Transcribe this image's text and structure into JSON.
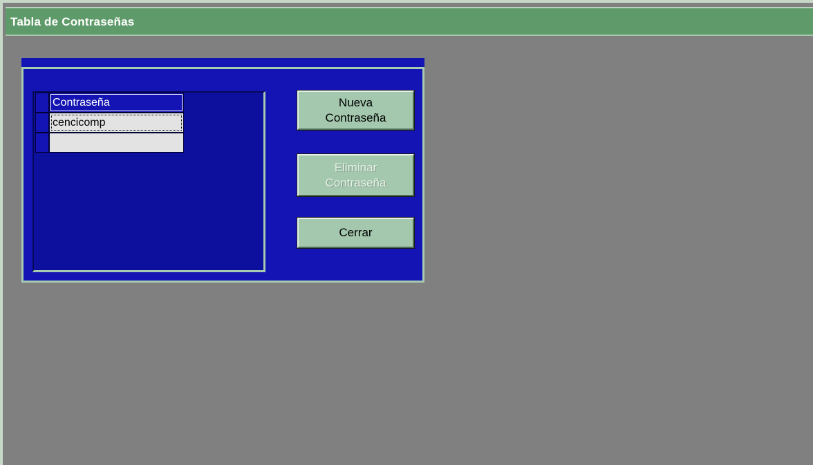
{
  "window": {
    "title": "Tabla de Contraseñas"
  },
  "grid": {
    "header": "Contraseña",
    "rows": [
      "cencicomp",
      ""
    ]
  },
  "buttons": {
    "new_password": [
      "Nueva",
      "Contraseña"
    ],
    "delete_password": [
      "Eliminar",
      "Contraseña"
    ],
    "close": "Cerrar"
  },
  "colors": {
    "titlebar": "#5f9b6a",
    "background": "#808080",
    "panel": "#1414b4",
    "button": "#a4c8ae"
  }
}
